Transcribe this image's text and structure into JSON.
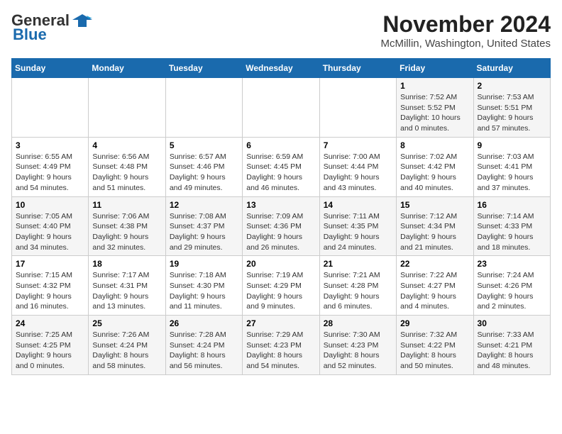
{
  "logo": {
    "general": "General",
    "blue": "Blue"
  },
  "header": {
    "month_year": "November 2024",
    "location": "McMillin, Washington, United States"
  },
  "days_of_week": [
    "Sunday",
    "Monday",
    "Tuesday",
    "Wednesday",
    "Thursday",
    "Friday",
    "Saturday"
  ],
  "weeks": [
    [
      {
        "day": "",
        "detail": ""
      },
      {
        "day": "",
        "detail": ""
      },
      {
        "day": "",
        "detail": ""
      },
      {
        "day": "",
        "detail": ""
      },
      {
        "day": "",
        "detail": ""
      },
      {
        "day": "1",
        "detail": "Sunrise: 7:52 AM\nSunset: 5:52 PM\nDaylight: 10 hours\nand 0 minutes."
      },
      {
        "day": "2",
        "detail": "Sunrise: 7:53 AM\nSunset: 5:51 PM\nDaylight: 9 hours\nand 57 minutes."
      }
    ],
    [
      {
        "day": "3",
        "detail": "Sunrise: 6:55 AM\nSunset: 4:49 PM\nDaylight: 9 hours\nand 54 minutes."
      },
      {
        "day": "4",
        "detail": "Sunrise: 6:56 AM\nSunset: 4:48 PM\nDaylight: 9 hours\nand 51 minutes."
      },
      {
        "day": "5",
        "detail": "Sunrise: 6:57 AM\nSunset: 4:46 PM\nDaylight: 9 hours\nand 49 minutes."
      },
      {
        "day": "6",
        "detail": "Sunrise: 6:59 AM\nSunset: 4:45 PM\nDaylight: 9 hours\nand 46 minutes."
      },
      {
        "day": "7",
        "detail": "Sunrise: 7:00 AM\nSunset: 4:44 PM\nDaylight: 9 hours\nand 43 minutes."
      },
      {
        "day": "8",
        "detail": "Sunrise: 7:02 AM\nSunset: 4:42 PM\nDaylight: 9 hours\nand 40 minutes."
      },
      {
        "day": "9",
        "detail": "Sunrise: 7:03 AM\nSunset: 4:41 PM\nDaylight: 9 hours\nand 37 minutes."
      }
    ],
    [
      {
        "day": "10",
        "detail": "Sunrise: 7:05 AM\nSunset: 4:40 PM\nDaylight: 9 hours\nand 34 minutes."
      },
      {
        "day": "11",
        "detail": "Sunrise: 7:06 AM\nSunset: 4:38 PM\nDaylight: 9 hours\nand 32 minutes."
      },
      {
        "day": "12",
        "detail": "Sunrise: 7:08 AM\nSunset: 4:37 PM\nDaylight: 9 hours\nand 29 minutes."
      },
      {
        "day": "13",
        "detail": "Sunrise: 7:09 AM\nSunset: 4:36 PM\nDaylight: 9 hours\nand 26 minutes."
      },
      {
        "day": "14",
        "detail": "Sunrise: 7:11 AM\nSunset: 4:35 PM\nDaylight: 9 hours\nand 24 minutes."
      },
      {
        "day": "15",
        "detail": "Sunrise: 7:12 AM\nSunset: 4:34 PM\nDaylight: 9 hours\nand 21 minutes."
      },
      {
        "day": "16",
        "detail": "Sunrise: 7:14 AM\nSunset: 4:33 PM\nDaylight: 9 hours\nand 18 minutes."
      }
    ],
    [
      {
        "day": "17",
        "detail": "Sunrise: 7:15 AM\nSunset: 4:32 PM\nDaylight: 9 hours\nand 16 minutes."
      },
      {
        "day": "18",
        "detail": "Sunrise: 7:17 AM\nSunset: 4:31 PM\nDaylight: 9 hours\nand 13 minutes."
      },
      {
        "day": "19",
        "detail": "Sunrise: 7:18 AM\nSunset: 4:30 PM\nDaylight: 9 hours\nand 11 minutes."
      },
      {
        "day": "20",
        "detail": "Sunrise: 7:19 AM\nSunset: 4:29 PM\nDaylight: 9 hours\nand 9 minutes."
      },
      {
        "day": "21",
        "detail": "Sunrise: 7:21 AM\nSunset: 4:28 PM\nDaylight: 9 hours\nand 6 minutes."
      },
      {
        "day": "22",
        "detail": "Sunrise: 7:22 AM\nSunset: 4:27 PM\nDaylight: 9 hours\nand 4 minutes."
      },
      {
        "day": "23",
        "detail": "Sunrise: 7:24 AM\nSunset: 4:26 PM\nDaylight: 9 hours\nand 2 minutes."
      }
    ],
    [
      {
        "day": "24",
        "detail": "Sunrise: 7:25 AM\nSunset: 4:25 PM\nDaylight: 9 hours\nand 0 minutes."
      },
      {
        "day": "25",
        "detail": "Sunrise: 7:26 AM\nSunset: 4:24 PM\nDaylight: 8 hours\nand 58 minutes."
      },
      {
        "day": "26",
        "detail": "Sunrise: 7:28 AM\nSunset: 4:24 PM\nDaylight: 8 hours\nand 56 minutes."
      },
      {
        "day": "27",
        "detail": "Sunrise: 7:29 AM\nSunset: 4:23 PM\nDaylight: 8 hours\nand 54 minutes."
      },
      {
        "day": "28",
        "detail": "Sunrise: 7:30 AM\nSunset: 4:23 PM\nDaylight: 8 hours\nand 52 minutes."
      },
      {
        "day": "29",
        "detail": "Sunrise: 7:32 AM\nSunset: 4:22 PM\nDaylight: 8 hours\nand 50 minutes."
      },
      {
        "day": "30",
        "detail": "Sunrise: 7:33 AM\nSunset: 4:21 PM\nDaylight: 8 hours\nand 48 minutes."
      }
    ]
  ]
}
